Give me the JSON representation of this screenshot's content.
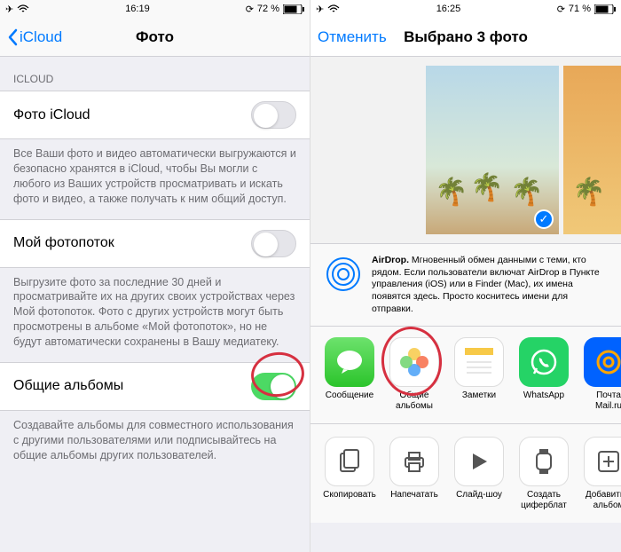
{
  "left": {
    "status": {
      "time": "16:19",
      "battery": "72 %"
    },
    "nav": {
      "back": "iCloud",
      "title": "Фото"
    },
    "section_header": "ICLOUD",
    "icloud_photo": {
      "label": "Фото iCloud",
      "footer": "Все Ваши фото и видео автоматически выгружаются и безопасно хранятся в iCloud, чтобы Вы могли с любого из Ваших устройств просматривать и искать фото и видео, а также получать к ним общий доступ."
    },
    "photostream": {
      "label": "Мой фотопоток",
      "footer": "Выгрузите фото за последние 30 дней и просматривайте их на других своих устройствах через Мой фотопоток. Фото с других устройств могут быть просмотрены в альбоме «Мой фотопоток», но не будут автоматически сохранены в Вашу медиатеку."
    },
    "shared_albums": {
      "label": "Общие альбомы",
      "footer": "Создавайте альбомы для совместного использования с другими пользователями или подписывайтесь на общие альбомы других пользователей."
    }
  },
  "right": {
    "status": {
      "time": "16:25",
      "battery": "71 %"
    },
    "nav": {
      "cancel": "Отменить",
      "title": "Выбрано 3 фото"
    },
    "airdrop": {
      "title": "AirDrop.",
      "text": "Мгновенный обмен данными с теми, кто рядом. Если пользователи включат AirDrop в Пункте управления (iOS) или в Finder (Mac), их имена появятся здесь. Просто коснитесь имени для отправки."
    },
    "apps": [
      {
        "label": "Сообщение"
      },
      {
        "label": "Общие альбомы"
      },
      {
        "label": "Заметки"
      },
      {
        "label": "WhatsApp"
      },
      {
        "label": "Почта Mail.ru"
      }
    ],
    "actions": [
      {
        "label": "Скопировать"
      },
      {
        "label": "Напечатать"
      },
      {
        "label": "Слайд-шоу"
      },
      {
        "label": "Создать циферблат"
      },
      {
        "label": "Добавить в альбом"
      }
    ]
  }
}
